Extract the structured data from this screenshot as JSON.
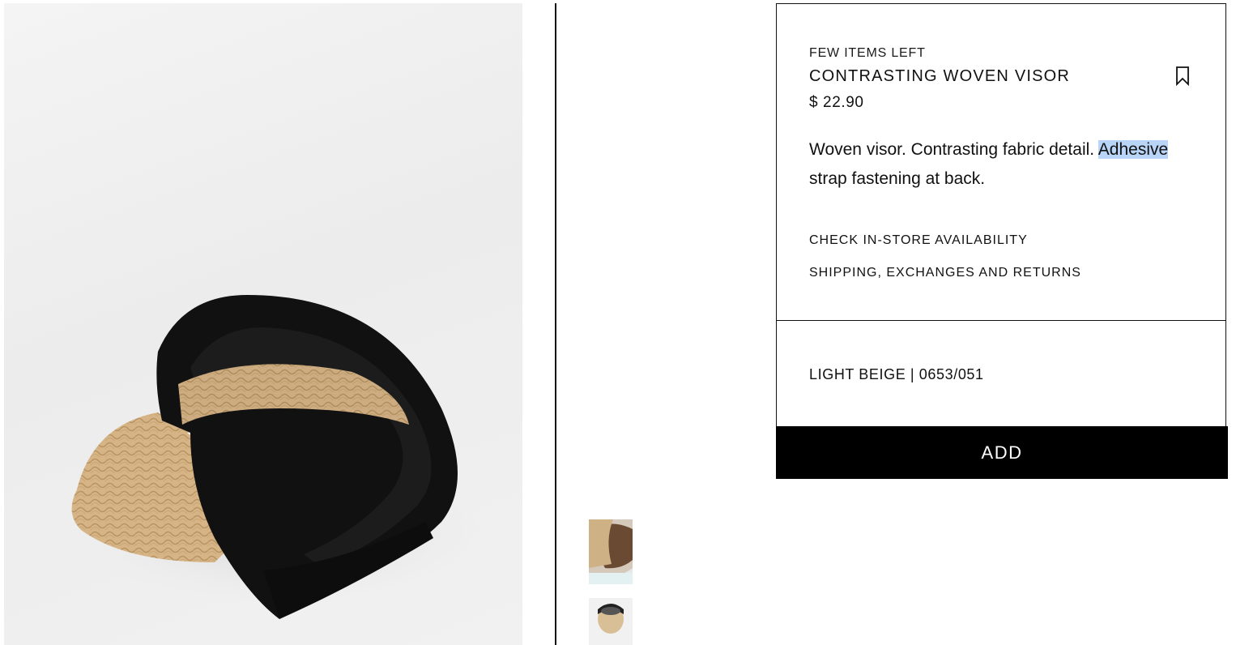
{
  "product": {
    "stock_notice": "FEW ITEMS LEFT",
    "title": "CONTRASTING WOVEN VISOR",
    "price": "$ 22.90",
    "description_part1": "Woven visor. Contrasting fabric detail. ",
    "description_highlight": "Adhesive",
    "description_part2": " strap fastening at back.",
    "color_ref": "LIGHT BEIGE | 0653/051"
  },
  "links": {
    "store_availability": "CHECK IN-STORE AVAILABILITY",
    "shipping": "SHIPPING, EXCHANGES AND RETURNS"
  },
  "actions": {
    "add_label": "ADD"
  },
  "icons": {
    "save": "bookmark-icon"
  },
  "colors": {
    "primary": "#000000",
    "background": "#ffffff",
    "text_selection": "#b8d4f6",
    "straw": "#d9b98a",
    "strap": "#111111"
  }
}
